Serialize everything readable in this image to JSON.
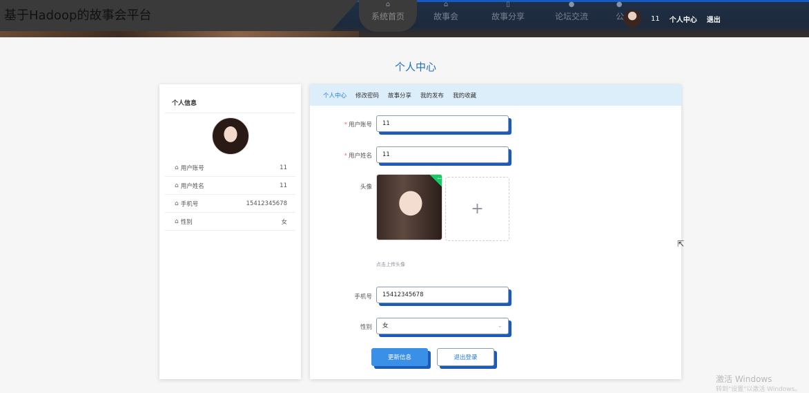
{
  "header": {
    "site_title": "基于Hadoop的故事会平台",
    "nav": [
      {
        "label": "系统首页",
        "icon": "home-icon"
      },
      {
        "label": "故事会",
        "icon": "home-icon"
      },
      {
        "label": "故事分享",
        "icon": "document-icon"
      },
      {
        "label": "论坛交流",
        "icon": "chat-icon"
      },
      {
        "label": "公告",
        "icon": "bell-icon"
      }
    ],
    "user_name": "11",
    "personal_center_link": "个人中心",
    "logout_link": "退出"
  },
  "page_title": "个人中心",
  "profile": {
    "heading": "个人信息",
    "rows": [
      {
        "label": "用户账号",
        "value": "11",
        "icon": "home-icon"
      },
      {
        "label": "用户姓名",
        "value": "11",
        "icon": "home-icon"
      },
      {
        "label": "手机号",
        "value": "15412345678",
        "icon": "home-icon"
      },
      {
        "label": "性别",
        "value": "女",
        "icon": "home-icon"
      }
    ]
  },
  "tabs": [
    {
      "label": "个人中心",
      "active": true
    },
    {
      "label": "修改密码",
      "active": false
    },
    {
      "label": "故事分享",
      "active": false
    },
    {
      "label": "我的发布",
      "active": false
    },
    {
      "label": "我的收藏",
      "active": false
    }
  ],
  "form": {
    "account_label": "用户账号",
    "account_value": "11",
    "name_label": "用户姓名",
    "name_value": "11",
    "avatar_label": "头像",
    "upload_tip": "点击上传头像",
    "phone_label": "手机号",
    "phone_value": "15412345678",
    "gender_label": "性别",
    "gender_value": "女",
    "update_button": "更新信息",
    "logout_button": "退出登录"
  },
  "watermark": {
    "line1": "激活 Windows",
    "line2": "转到\"设置\"以激活 Windows。"
  },
  "colors": {
    "accent": "#1f7ad6",
    "tab_bar": "#ddeefb",
    "primary_button": "#3a8fe6",
    "field_shadow": "#1d5bb8",
    "header_bg": "#1d2a3d"
  }
}
